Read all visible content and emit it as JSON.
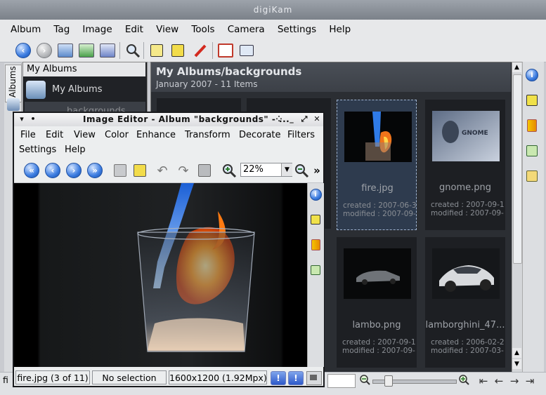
{
  "app": {
    "title": "digiKam"
  },
  "menu": [
    "Album",
    "Tag",
    "Image",
    "Edit",
    "View",
    "Tools",
    "Camera",
    "Settings",
    "Help"
  ],
  "sidebar": {
    "tab_label": "Albums",
    "header": "My Albums",
    "root_item": "My Albums",
    "child_item": "backgrounds"
  },
  "content": {
    "title": "My Albums/backgrounds",
    "subtitle": "January 2007 - 11 Items",
    "items": [
      {
        "name": "fire.jpg",
        "created": "created : 2007-06-3...",
        "modified": "modified : 2007-09-...",
        "selected": true
      },
      {
        "name": "gnome.png",
        "created": "created : 2007-09-1...",
        "modified": "modified : 2007-09-...",
        "selected": false
      },
      {
        "name": "lambo.png",
        "created": "created : 2007-09-1...",
        "modified": "modified : 2007-09-...",
        "selected": false
      },
      {
        "name": "lamborghini_47...",
        "created": "created : 2006-02-2...",
        "modified": "modified : 2007-03-...",
        "selected": false
      }
    ]
  },
  "status_left": "fi",
  "editor": {
    "title": "Image Editor - Album \"backgrounds\" - ...",
    "menu_row1": [
      "File",
      "Edit",
      "View",
      "Color",
      "Enhance",
      "Transform",
      "Decorate",
      "Filters"
    ],
    "menu_row2": [
      "Settings",
      "Help"
    ],
    "zoom": "22%",
    "more": "»",
    "status": {
      "file": "fire.jpg (3 of 11)",
      "selection": "No selection",
      "dimensions": "1600x1200 (1.92Mpx)"
    }
  },
  "icons": [
    "back-icon",
    "forward-icon",
    "new-album-icon",
    "import-icon",
    "export-icon",
    "search-icon",
    "edit-icon",
    "pencil-icon",
    "fullscreen-icon",
    "slideshow-icon",
    "info-icon",
    "metadata-icon",
    "color-icon",
    "geolocation-icon",
    "tag-icon",
    "zoom-in-icon",
    "zoom-out-icon",
    "save-icon",
    "undo-icon",
    "redo-icon",
    "revert-icon",
    "first-icon",
    "previous-icon",
    "next-icon",
    "last-icon"
  ],
  "colors": {
    "content_bg": "#2b2e33",
    "selected_border": "#9fb3d0",
    "accent_blue": "#3a7be0"
  }
}
